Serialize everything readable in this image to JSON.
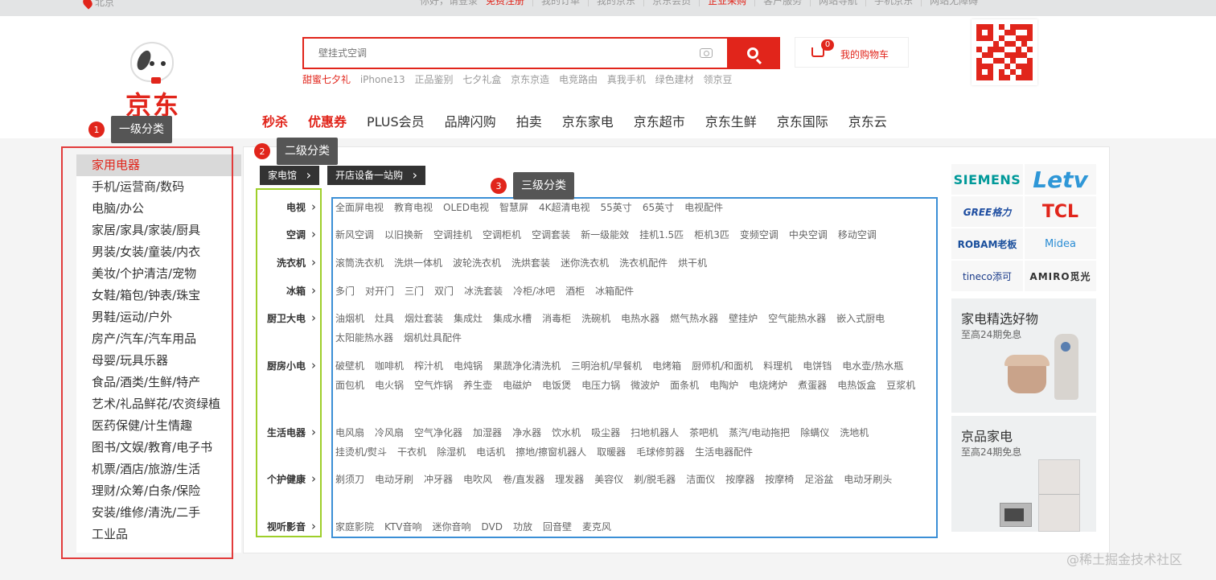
{
  "topbar": {
    "location": "北京",
    "links": [
      "你好，请登录",
      "免费注册",
      "我的订单",
      "我的京东",
      "京东会员",
      "企业采购",
      "客户服务",
      "网站导航",
      "手机京东",
      "网站无障碍"
    ]
  },
  "logo": {
    "wordmark": "京东"
  },
  "search": {
    "placeholder": "壁挂式空调",
    "hotwords": [
      "甜蜜七夕礼",
      "iPhone13",
      "正品鉴别",
      "七夕礼盒",
      "京东京造",
      "电竞路由",
      "真我手机",
      "绿色建材",
      "领京豆"
    ]
  },
  "cart": {
    "label": "我的购物车",
    "count": "0"
  },
  "mainnav": [
    "秒杀",
    "优惠券",
    "PLUS会员",
    "品牌闪购",
    "拍卖",
    "京东家电",
    "京东超市",
    "京东生鲜",
    "京东国际",
    "京东云"
  ],
  "tags": {
    "t1": {
      "num": "1",
      "text": "一级分类"
    },
    "t2": {
      "num": "2",
      "text": "二级分类"
    },
    "t3": {
      "num": "3",
      "text": "三级分类"
    }
  },
  "leftcat": [
    "家用电器",
    "手机/运营商/数码",
    "电脑/办公",
    "家居/家具/家装/厨具",
    "男装/女装/童装/内衣",
    "美妆/个护清洁/宠物",
    "女鞋/箱包/钟表/珠宝",
    "男鞋/运动/户外",
    "房产/汽车/汽车用品",
    "母婴/玩具乐器",
    "食品/酒类/生鲜/特产",
    "艺术/礼品鲜花/农资绿植",
    "医药保健/计生情趣",
    "图书/文娱/教育/电子书",
    "机票/酒店/旅游/生活",
    "理财/众筹/白条/保险",
    "安装/维修/清洗/二手",
    "工业品"
  ],
  "subtabs": [
    "家电馆",
    "开店设备一站购"
  ],
  "categories": [
    {
      "name": "电视",
      "items": [
        "全面屏电视",
        "教育电视",
        "OLED电视",
        "智慧屏",
        "4K超清电视",
        "55英寸",
        "65英寸",
        "电视配件"
      ]
    },
    {
      "name": "空调",
      "items": [
        "新风空调",
        "以旧换新",
        "空调挂机",
        "空调柜机",
        "空调套装",
        "新一级能效",
        "挂机1.5匹",
        "柜机3匹",
        "变频空调",
        "中央空调",
        "移动空调"
      ]
    },
    {
      "name": "洗衣机",
      "items": [
        "滚筒洗衣机",
        "洗烘一体机",
        "波轮洗衣机",
        "洗烘套装",
        "迷你洗衣机",
        "洗衣机配件",
        "烘干机"
      ]
    },
    {
      "name": "冰箱",
      "items": [
        "多门",
        "对开门",
        "三门",
        "双门",
        "冰洗套装",
        "冷柜/冰吧",
        "酒柜",
        "冰箱配件"
      ]
    },
    {
      "name": "厨卫大电",
      "items": [
        "油烟机",
        "灶具",
        "烟灶套装",
        "集成灶",
        "集成水槽",
        "消毒柜",
        "洗碗机",
        "电热水器",
        "燃气热水器",
        "壁挂炉",
        "空气能热水器",
        "嵌入式厨电",
        "太阳能热水器",
        "烟机灶具配件"
      ]
    },
    {
      "name": "厨房小电",
      "items": [
        "破壁机",
        "咖啡机",
        "榨汁机",
        "电炖锅",
        "果蔬净化清洗机",
        "三明治机/早餐机",
        "电烤箱",
        "厨师机/和面机",
        "料理机",
        "电饼铛",
        "电水壶/热水瓶",
        "面包机",
        "电火锅",
        "空气炸锅",
        "养生壶",
        "电磁炉",
        "电饭煲",
        "电压力锅",
        "微波炉",
        "面条机",
        "电陶炉",
        "电烧烤炉",
        "煮蛋器",
        "电热饭盒",
        "豆浆机"
      ]
    },
    {
      "name": "生活电器",
      "items": [
        "电风扇",
        "冷风扇",
        "空气净化器",
        "加湿器",
        "净水器",
        "饮水机",
        "吸尘器",
        "扫地机器人",
        "茶吧机",
        "蒸汽/电动拖把",
        "除螨仪",
        "洗地机",
        "挂烫机/熨斗",
        "干衣机",
        "除湿机",
        "电话机",
        "擦地/擦窗机器人",
        "取暖器",
        "毛球修剪器",
        "生活电器配件"
      ]
    },
    {
      "name": "个护健康",
      "items": [
        "剃须刀",
        "电动牙刷",
        "冲牙器",
        "电吹风",
        "卷/直发器",
        "理发器",
        "美容仪",
        "剃/脱毛器",
        "洁面仪",
        "按摩器",
        "按摩椅",
        "足浴盆",
        "电动牙刷头"
      ]
    },
    {
      "name": "视听影音",
      "items": [
        "家庭影院",
        "KTV音响",
        "迷你音响",
        "DVD",
        "功放",
        "回音壁",
        "麦克风"
      ]
    }
  ],
  "brands": [
    "SIEMENS",
    "Letv",
    "GREE格力",
    "TCL",
    "ROBAM老板",
    "Midea",
    "tineco添可",
    "AMIRO觅光"
  ],
  "promos": [
    {
      "title": "家电精选好物",
      "sub": "至高24期免息"
    },
    {
      "title": "京品家电",
      "sub": "至高24期免息"
    }
  ],
  "watermark": "@稀土掘金技术社区"
}
